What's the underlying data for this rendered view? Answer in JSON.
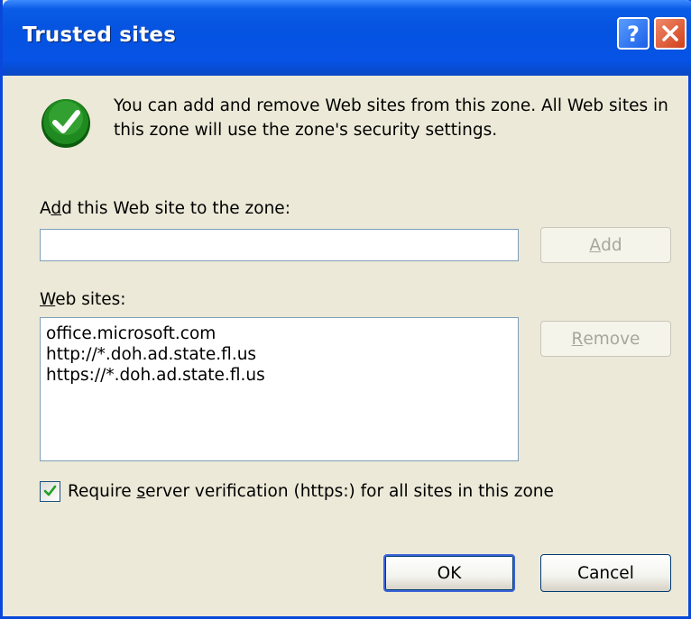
{
  "window": {
    "title": "Trusted sites",
    "help_button": "?",
    "close_button": "X"
  },
  "info": {
    "icon": "green-check-icon",
    "text": "You can add and remove Web sites from this zone. All Web sites in this zone will use the zone's security settings."
  },
  "add_site": {
    "label_pre": "A",
    "label_accel": "d",
    "label_post": "d this Web site to the zone:",
    "input_value": "",
    "add_button_accel": "A",
    "add_button_rest": "dd"
  },
  "sites": {
    "label_accel": "W",
    "label_post": "eb sites:",
    "items": [
      "office.microsoft.com",
      "http://*.doh.ad.state.fl.us",
      "https://*.doh.ad.state.fl.us"
    ],
    "remove_button_accel": "R",
    "remove_button_rest": "emove"
  },
  "verification": {
    "checked": true,
    "label_pre": "Require ",
    "label_accel": "s",
    "label_post": "erver verification (https:) for all sites in this zone"
  },
  "footer": {
    "ok_label": "OK",
    "cancel_label": "Cancel"
  },
  "colors": {
    "titlebar": "#0553e0",
    "dialog_bg": "#ece9d8",
    "check_green": "#1f8a1f"
  }
}
